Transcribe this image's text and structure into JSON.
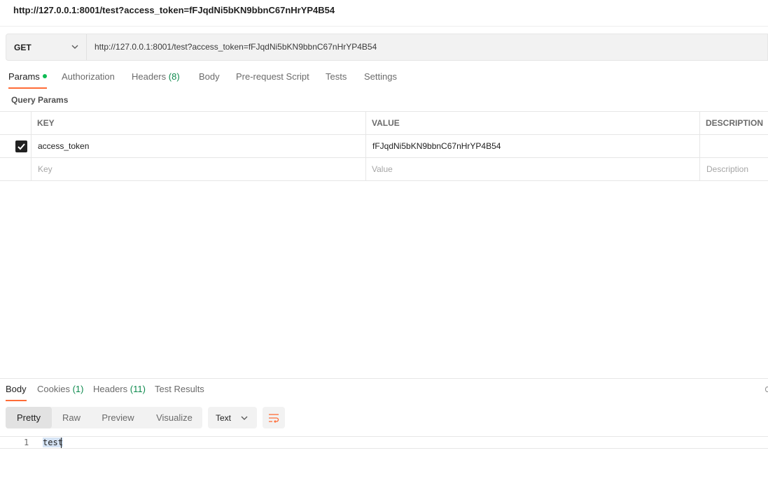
{
  "window": {
    "title": "http://127.0.0.1:8001/test?access_token=fFJqdNi5bKN9bbnC67nHrYP4B54"
  },
  "request": {
    "method": "GET",
    "url": "http://127.0.0.1:8001/test?access_token=fFJqdNi5bKN9bbnC67nHrYP4B54"
  },
  "request_tabs": [
    {
      "label": "Params",
      "active": true,
      "indicator": "green-dot"
    },
    {
      "label": "Authorization"
    },
    {
      "label": "Headers",
      "count": "(8)"
    },
    {
      "label": "Body"
    },
    {
      "label": "Pre-request Script"
    },
    {
      "label": "Tests"
    },
    {
      "label": "Settings"
    }
  ],
  "query_params": {
    "section_label": "Query Params",
    "headers": {
      "key": "KEY",
      "value": "VALUE",
      "description": "DESCRIPTION"
    },
    "rows": [
      {
        "checked": true,
        "key": "access_token",
        "value": "fFJqdNi5bKN9bbnC67nHrYP4B54",
        "description": ""
      }
    ],
    "placeholders": {
      "key": "Key",
      "value": "Value",
      "description": "Description"
    }
  },
  "response_tabs": [
    {
      "label": "Body",
      "active": true
    },
    {
      "label": "Cookies",
      "count": "(1)"
    },
    {
      "label": "Headers",
      "count": "(11)"
    },
    {
      "label": "Test Results"
    }
  ],
  "response_view": {
    "modes": [
      "Pretty",
      "Raw",
      "Preview",
      "Visualize"
    ],
    "active_mode": "Pretty",
    "format": "Text",
    "wrap_icon": "wrap-lines-icon"
  },
  "response_body": {
    "lines": [
      {
        "number": "1",
        "text": "test"
      }
    ]
  },
  "colors": {
    "accent": "#ff6c37",
    "count": "#0d8a4d",
    "indicator": "#0cbb52"
  }
}
